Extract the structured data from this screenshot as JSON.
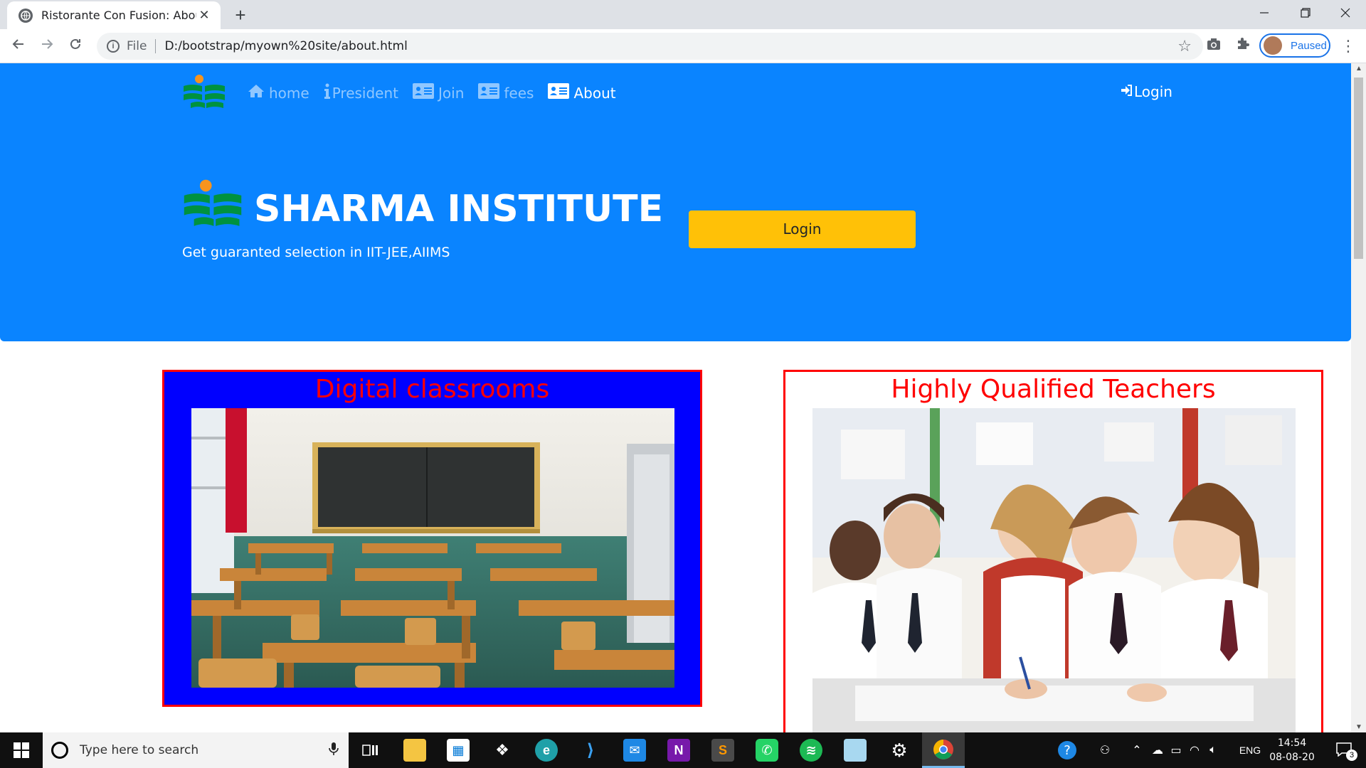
{
  "browser": {
    "tab_title": "Ristorante Con Fusion: About Us",
    "tab_close": "✕",
    "new_tab": "+",
    "scheme": "File",
    "url": "D:/bootstrap/myown%20site/about.html",
    "profile_status": "Paused"
  },
  "navbar": {
    "items": [
      {
        "label": "home",
        "icon": "home-icon"
      },
      {
        "label": "President",
        "icon": "info-icon"
      },
      {
        "label": "Join",
        "icon": "address-card-icon"
      },
      {
        "label": "fees",
        "icon": "address-card-icon"
      },
      {
        "label": "About",
        "icon": "address-card-icon",
        "active": true
      }
    ],
    "login_label": "Login"
  },
  "jumbotron": {
    "title": "SHARMA INSTITUTE",
    "subtitle": "Get guaranted selection in IIT-JEE,AIIMS",
    "login_button": "Login"
  },
  "cards": [
    {
      "title": "Digital classrooms",
      "image": "classroom-photo",
      "bg": "#0000ff"
    },
    {
      "title": "Highly Qualified Teachers",
      "image": "students-writing-photo",
      "bg": "#ffffff"
    }
  ],
  "taskbar": {
    "search_placeholder": "Type here to search",
    "language": "ENG",
    "time": "14:54",
    "date": "08-08-20",
    "notification_count": "3"
  },
  "colors": {
    "primary": "#0a84ff",
    "warning": "#ffc107",
    "card_border": "#ff0000",
    "card_title": "#ff0000"
  }
}
